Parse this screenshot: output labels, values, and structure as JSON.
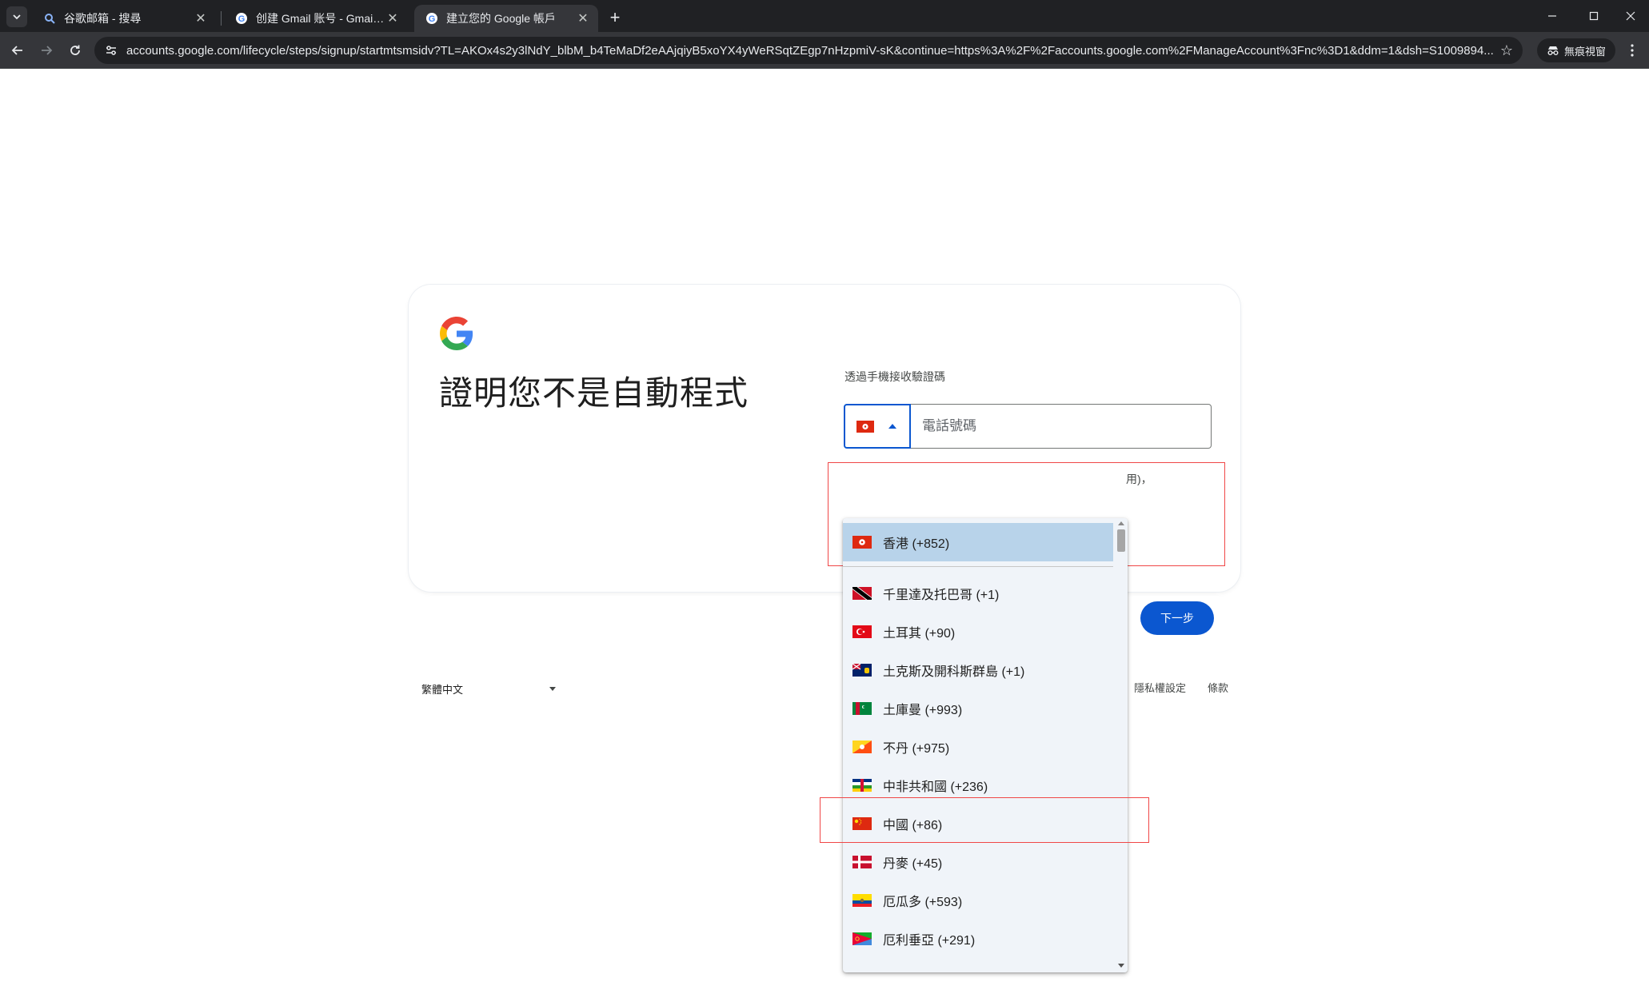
{
  "browser": {
    "tabs": [
      {
        "title": "谷歌邮箱 - 搜尋",
        "active": false
      },
      {
        "title": "创建 Gmail 账号 - Gmail帮助",
        "active": false
      },
      {
        "title": "建立您的 Google 帳戶",
        "active": true
      }
    ],
    "url": "accounts.google.com/lifecycle/steps/signup/startmtsmsidv?TL=AKOx4s2y3lNdY_blbM_b4TeMaDf2eAAjqiyB5xoYX4yWeRSqtZEgp7nHzpmiV-sK&continue=https%3A%2F%2Faccounts.google.com%2FManageAccount%3Fnc%3D1&ddm=1&dsh=S1009894...",
    "incognito_label": "無痕視窗"
  },
  "page": {
    "heading": "證明您不是自動程式",
    "field_label": "透過手機接收驗證碼",
    "phone_placeholder": "電話號碼",
    "helper_tail": "用)，",
    "next_button": "下一步",
    "language": "繁體中文",
    "footer_links": [
      "隱私權設定",
      "條款"
    ]
  },
  "dropdown": {
    "selected": {
      "label": "香港 (+852)",
      "flag": "hk"
    },
    "items": [
      {
        "label": "千里達及托巴哥 (+1)",
        "flag": "tt"
      },
      {
        "label": "土耳其 (+90)",
        "flag": "tr"
      },
      {
        "label": "土克斯及開科斯群島 (+1)",
        "flag": "tc"
      },
      {
        "label": "土庫曼 (+993)",
        "flag": "tm"
      },
      {
        "label": "不丹 (+975)",
        "flag": "bt"
      },
      {
        "label": "中非共和國 (+236)",
        "flag": "cf"
      },
      {
        "label": "中國 (+86)",
        "flag": "cn"
      },
      {
        "label": "丹麥 (+45)",
        "flag": "dk"
      },
      {
        "label": "厄瓜多 (+593)",
        "flag": "ec"
      },
      {
        "label": "厄利垂亞 (+291)",
        "flag": "er"
      }
    ]
  },
  "colors": {
    "accent": "#0b57d0",
    "annotation": "#f04747",
    "selected_row": "#b8d3ea",
    "chrome_dark": "#202124"
  }
}
